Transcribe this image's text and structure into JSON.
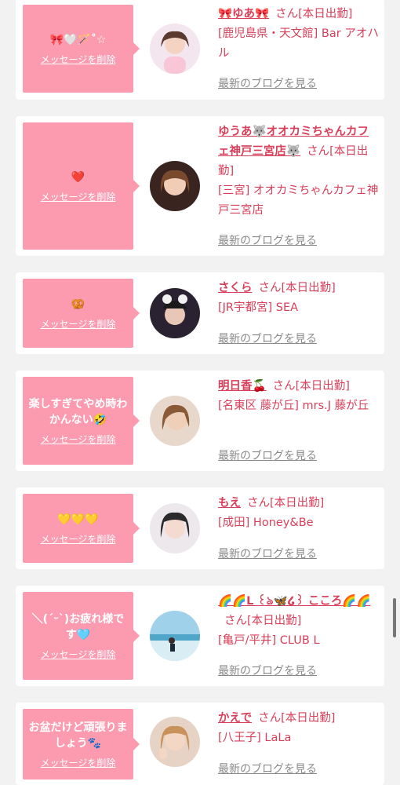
{
  "delete_label": "メッセージを削除",
  "blog_label": "最新のブログを見る",
  "san": "さん",
  "cards": [
    {
      "message": "🎀🤍🪄˚☆",
      "name": "🎀ゆあ🎀",
      "status": "[本日出勤]",
      "area": "[鹿児島県・天文館] Bar アオハル"
    },
    {
      "message": "❤️",
      "name": "ゆうあ🐺オオカミちゃんカフェ神戸三宮店🐺",
      "status": "[本日出勤]",
      "area": "[三宮] オオカミちゃんカフェ神戸三宮店"
    },
    {
      "message": "🥨",
      "name": "さくら",
      "status": "[本日出勤]",
      "area": "[JR宇都宮] SEA"
    },
    {
      "message": "楽しすぎてやめ時わかんない🤣",
      "name": "明日香🍒",
      "status": "[本日出勤]",
      "area": "[名東区 藤が丘] mrs.J 藤が丘"
    },
    {
      "message": "💛💛💛",
      "name": "もえ",
      "status": "[本日出勤]",
      "area": "[成田] Honey&Be"
    },
    {
      "message": "＼(ˊᵕˋ)お疲れ様です🩵",
      "name": "🌈🌈L ꒰ঌ🦋໒꒱ こころ🌈🌈",
      "status": "[本日出勤]",
      "area": "[亀戸/平井] CLUB L"
    },
    {
      "message": "お盆だけど頑張りましょう🐾",
      "name": "かえで",
      "status": "[本日出勤]",
      "area": "[八王子] LaLa"
    }
  ]
}
